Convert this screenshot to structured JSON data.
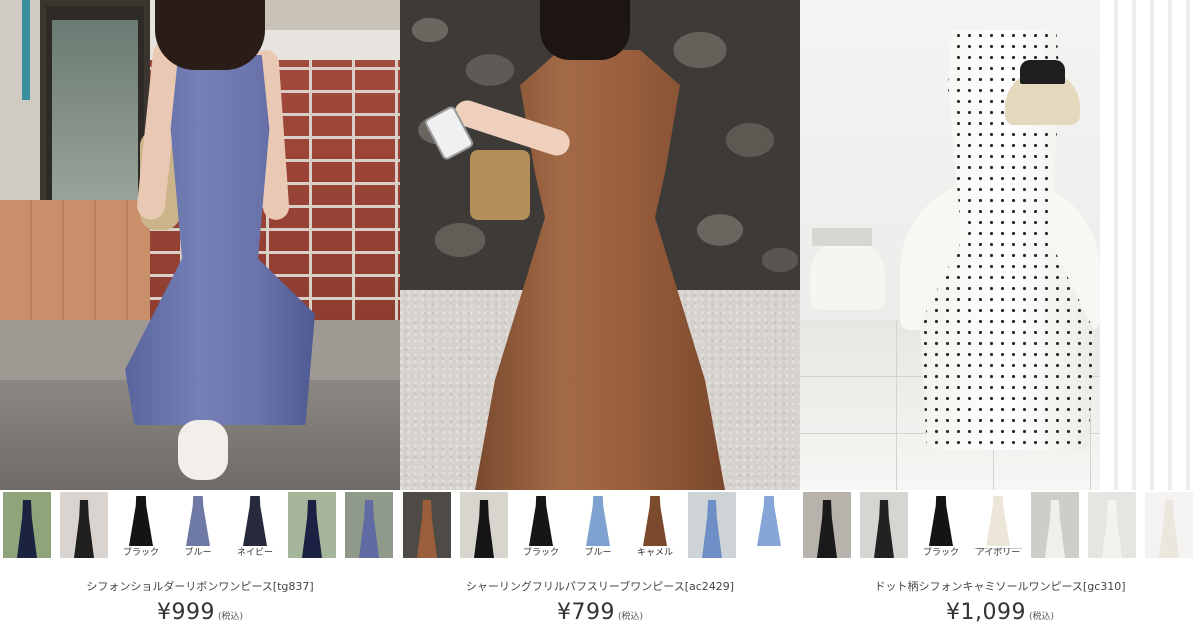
{
  "products": [
    {
      "name": "シフォンショルダーリボンワンピース[tg837]",
      "price": "¥999",
      "tax_label": "(税込)",
      "dress_color": "#6a74aa",
      "thumbnails": [
        {
          "label": "",
          "kind": "photo",
          "color": "#1c2340",
          "bg": "#8fa47a"
        },
        {
          "label": "",
          "kind": "photo",
          "color": "#1f1f1f",
          "bg": "#d9d4cf"
        },
        {
          "label": "ブラック",
          "kind": "swatch",
          "color": "#141414"
        },
        {
          "label": "ブルー",
          "kind": "swatch",
          "color": "#6f79a6"
        },
        {
          "label": "ネイビー",
          "kind": "swatch",
          "color": "#262a3c"
        },
        {
          "label": "",
          "kind": "photo",
          "color": "#1b2142",
          "bg": "#a7b59a"
        },
        {
          "label": "",
          "kind": "photo",
          "color": "#5f6ba2",
          "bg": "#8f9a8a"
        }
      ]
    },
    {
      "name": "シャーリングフリルパフスリーブワンピース[ac2429]",
      "price": "¥799",
      "tax_label": "(税込)",
      "dress_color": "#9a603e",
      "thumbnails": [
        {
          "label": "",
          "kind": "photo",
          "color": "#9b5e3a",
          "bg": "#4e4a46"
        },
        {
          "label": "",
          "kind": "photo",
          "color": "#151515",
          "bg": "#d8d4ce"
        },
        {
          "label": "ブラック",
          "kind": "swatch",
          "color": "#161616"
        },
        {
          "label": "ブルー",
          "kind": "swatch",
          "color": "#7ea2d0"
        },
        {
          "label": "キャメル",
          "kind": "swatch",
          "color": "#7b4a2c"
        },
        {
          "label": "",
          "kind": "photo",
          "color": "#6e8fc6",
          "bg": "#cdd3d6"
        },
        {
          "label": "",
          "kind": "swatch",
          "color": "#85a6d6"
        }
      ]
    },
    {
      "name": "ドット柄シフォンキャミソールワンピース[gc310]",
      "price": "¥1,099",
      "tax_label": "(税込)",
      "dress_color": "#f3f2ee",
      "thumbnails": [
        {
          "label": "",
          "kind": "photo",
          "color": "#1a1a1a",
          "bg": "#b7b2ab"
        },
        {
          "label": "",
          "kind": "photo",
          "color": "#222222",
          "bg": "#d7d5d1"
        },
        {
          "label": "ブラック",
          "kind": "swatch",
          "color": "#141414"
        },
        {
          "label": "アイボリー",
          "kind": "swatch",
          "color": "#ece6d8",
          "bordered": true
        },
        {
          "label": "",
          "kind": "photo",
          "color": "#f1efe9",
          "bg": "#cfcdc8"
        },
        {
          "label": "",
          "kind": "photo",
          "color": "#f3f2ee",
          "bg": "#e6e5e2"
        },
        {
          "label": "",
          "kind": "photo",
          "color": "#ebe7df",
          "bg": "#f4f3f1"
        }
      ]
    }
  ]
}
